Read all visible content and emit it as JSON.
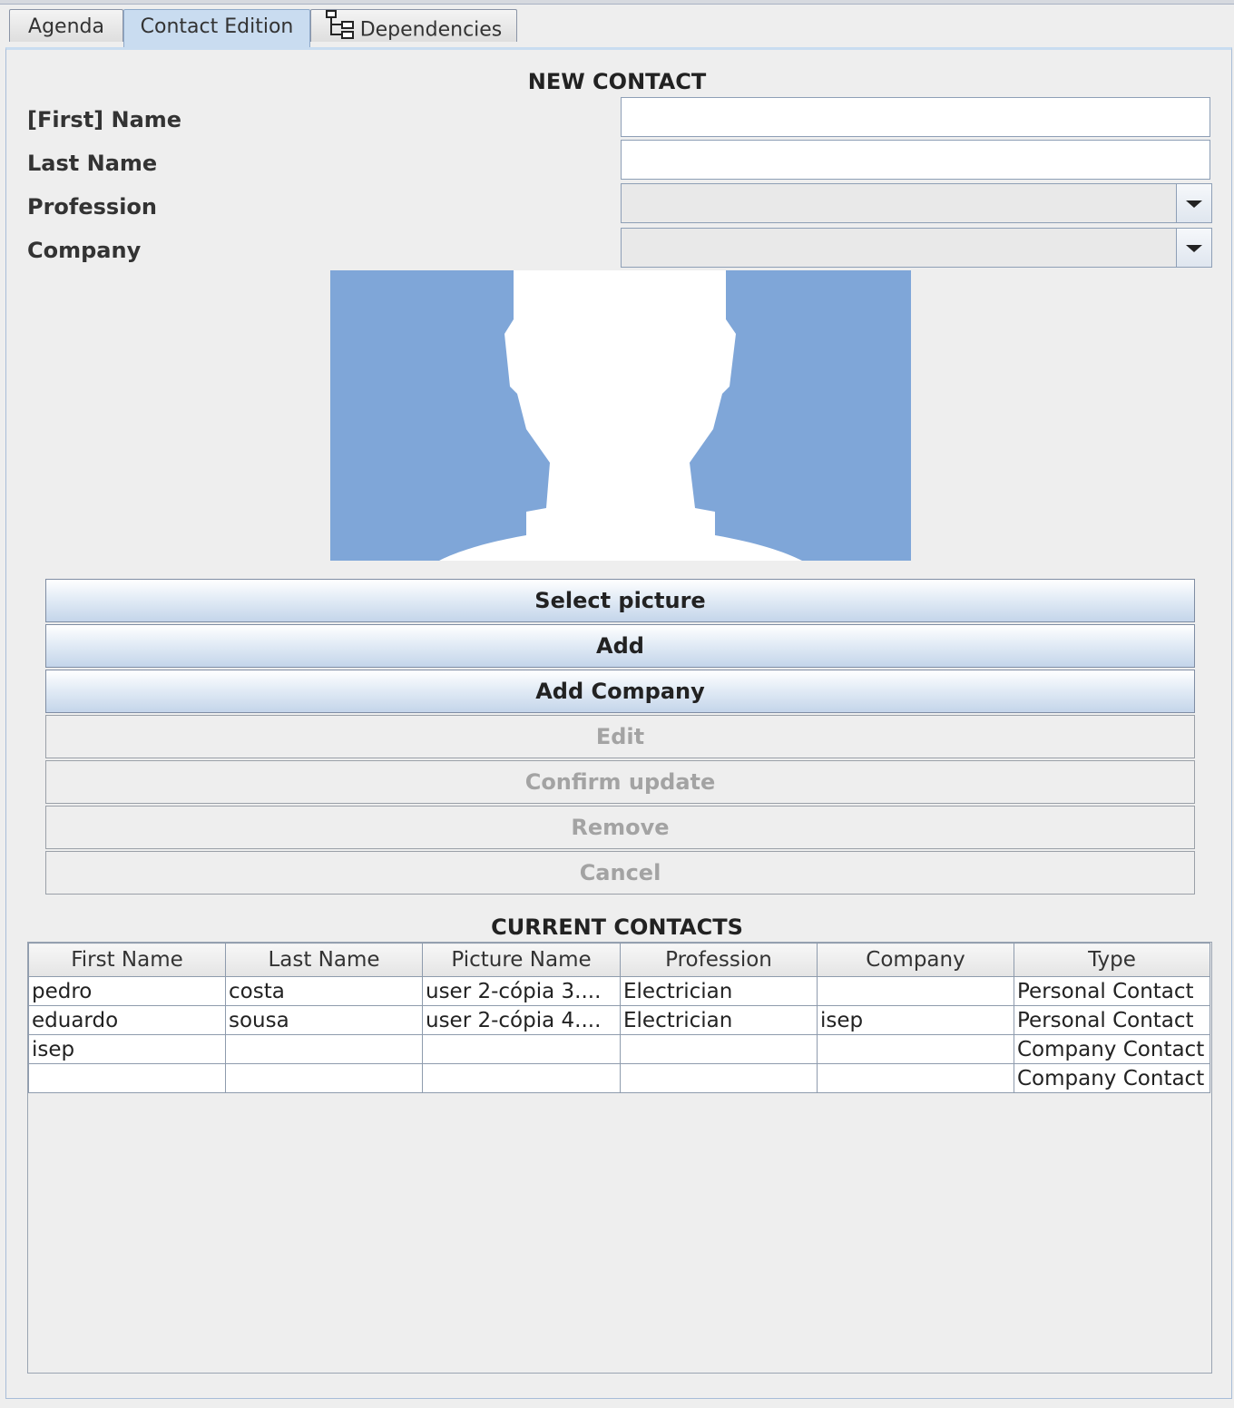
{
  "tabs": [
    {
      "label": "Agenda"
    },
    {
      "label": "Contact Edition"
    },
    {
      "label": "Dependencies"
    }
  ],
  "form": {
    "title": "NEW CONTACT",
    "first_name_label": "[First] Name",
    "first_name_value": "",
    "last_name_label": "Last Name",
    "last_name_value": "",
    "profession_label": "Profession",
    "profession_value": "",
    "company_label": "Company",
    "company_value": ""
  },
  "avatar": {
    "icon": "user-silhouette-icon",
    "background_color": "#7fa6d8",
    "figure_color": "#ffffff"
  },
  "buttons": {
    "select_picture": "Select picture",
    "add": "Add",
    "add_company": "Add Company",
    "edit": "Edit",
    "confirm_update": "Confirm update",
    "remove": "Remove",
    "cancel": "Cancel"
  },
  "contacts": {
    "title": "CURRENT CONTACTS",
    "columns": [
      "First Name",
      "Last Name",
      "Picture Name",
      "Profession",
      "Company",
      "Type"
    ],
    "rows": [
      [
        "pedro",
        "costa",
        "user 2-cópia 3....",
        "Electrician",
        "",
        "Personal Contact"
      ],
      [
        "eduardo",
        "sousa",
        "user 2-cópia 4....",
        "Electrician",
        "isep",
        "Personal Contact"
      ],
      [
        "isep",
        "",
        "",
        "",
        "",
        "Company Contact"
      ],
      [
        "",
        "",
        "",
        "",
        "",
        "Company Contact"
      ]
    ]
  }
}
